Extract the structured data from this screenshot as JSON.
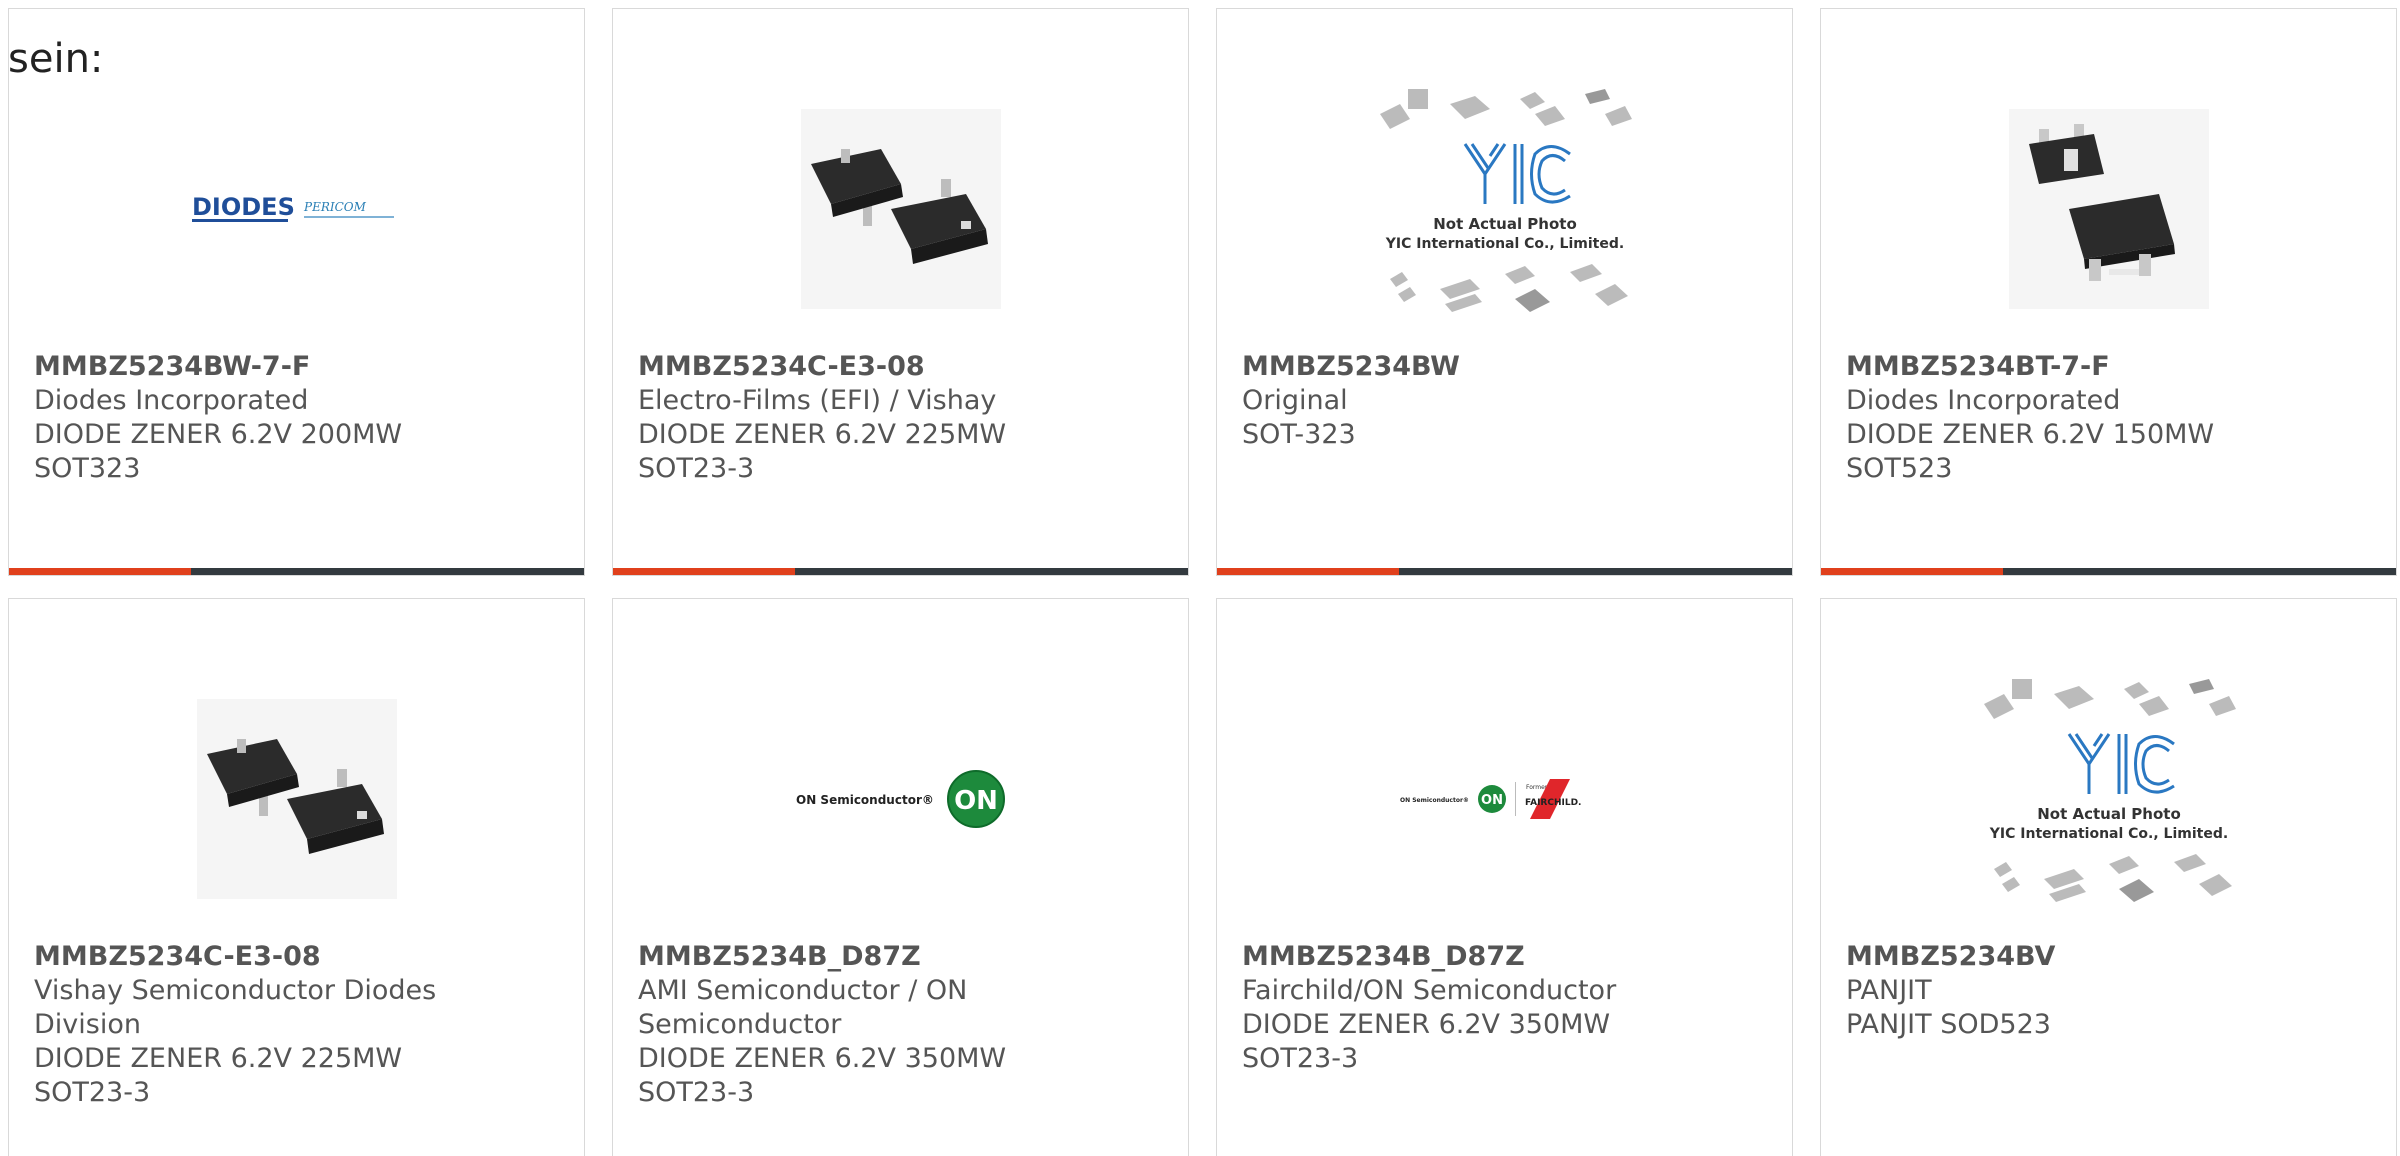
{
  "intro_text": "sein:",
  "colors": {
    "accent": "#e0401c",
    "bar": "#333a3f",
    "text": "#555555",
    "border": "#d9d9d9"
  },
  "products": [
    {
      "part": "MMBZ5234BW-7-F",
      "lines": [
        "Diodes Incorporated",
        "DIODE ZENER 6.2V 200MW",
        "SOT323"
      ],
      "image": "diodes-pericom-logo"
    },
    {
      "part": "MMBZ5234C-E3-08",
      "lines": [
        "Electro-Films (EFI) / Vishay",
        "DIODE ZENER 6.2V 225MW",
        "SOT23-3"
      ],
      "image": "sot23-package-photo"
    },
    {
      "part": "MMBZ5234BW",
      "lines": [
        "Original",
        "SOT-323"
      ],
      "image": "yic-not-actual-photo",
      "image_text": [
        "Not Actual Photo",
        "YIC International Co., Limited."
      ]
    },
    {
      "part": "MMBZ5234BT-7-F",
      "lines": [
        "Diodes Incorporated",
        "DIODE ZENER 6.2V 150MW",
        "SOT523"
      ],
      "image": "sot523-package-photo"
    },
    {
      "part": "MMBZ5234C-E3-08",
      "lines": [
        "Vishay Semiconductor Diodes",
        "Division",
        "DIODE ZENER 6.2V 225MW",
        "SOT23-3"
      ],
      "image": "sot23-package-photo"
    },
    {
      "part": "MMBZ5234B_D87Z",
      "lines": [
        "AMI Semiconductor / ON",
        "Semiconductor",
        "DIODE ZENER 6.2V 350MW",
        "SOT23-3"
      ],
      "image": "on-semiconductor-logo",
      "image_text": [
        "ON Semiconductor®",
        "ON"
      ]
    },
    {
      "part": "MMBZ5234B_D87Z",
      "lines": [
        "Fairchild/ON Semiconductor",
        "DIODE ZENER 6.2V 350MW",
        "SOT23-3"
      ],
      "image": "on-fairchild-logo",
      "image_text": [
        "ON Semiconductor®",
        "ON",
        "Formerly",
        "FAIRCHILD."
      ]
    },
    {
      "part": "MMBZ5234BV",
      "lines": [
        "PANJIT",
        "PANJIT SOD523"
      ],
      "image": "yic-not-actual-photo",
      "image_text": [
        "Not Actual Photo",
        "YIC International Co., Limited."
      ]
    }
  ]
}
